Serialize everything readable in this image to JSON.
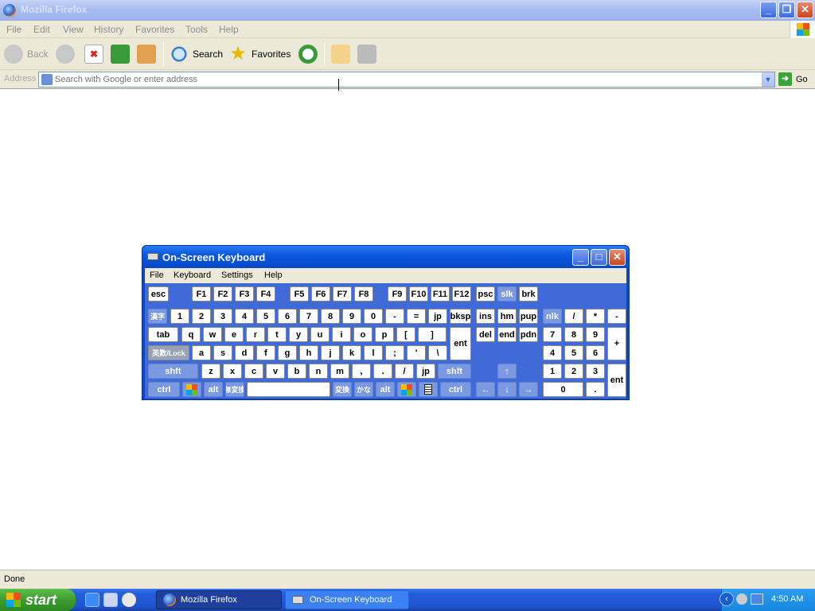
{
  "window": {
    "title": "Mozilla Firefox"
  },
  "menu": [
    "File",
    "Edit",
    "View",
    "History",
    "Favorites",
    "Tools",
    "Help"
  ],
  "toolbar": {
    "back": "Back",
    "search": "Search",
    "favorites": "Favorites"
  },
  "address": {
    "label": "Address",
    "placeholder": "Search with Google or enter address",
    "go": "Go"
  },
  "status": {
    "text": "Done"
  },
  "taskbar": {
    "start": "start",
    "tasks": [
      "Mozilla Firefox",
      "On-Screen Keyboard"
    ],
    "clock": "4:50 AM"
  },
  "osk": {
    "title": "On-Screen Keyboard",
    "menu": [
      "File",
      "Keyboard",
      "Settings",
      "Help"
    ],
    "keys": {
      "esc": "esc",
      "f1": "F1",
      "f2": "F2",
      "f3": "F3",
      "f4": "F4",
      "f5": "F5",
      "f6": "F6",
      "f7": "F7",
      "f8": "F8",
      "f9": "F9",
      "f10": "F10",
      "f11": "F11",
      "f12": "F12",
      "psc": "psc",
      "slk": "slk",
      "brk": "brk",
      "kanji": "漢字",
      "n1": "1",
      "n2": "2",
      "n3": "3",
      "n4": "4",
      "n5": "5",
      "n6": "6",
      "n7": "7",
      "n8": "8",
      "n9": "9",
      "n0": "0",
      "minus": "-",
      "equal": "=",
      "jp1": "jp",
      "bksp": "bksp",
      "ins": "ins",
      "hm": "hm",
      "pup": "pup",
      "nlk": "nlk",
      "kpdiv": "/",
      "kpmul": "*",
      "kpsub": "-",
      "tab": "tab",
      "q": "q",
      "w": "w",
      "e": "e",
      "r": "r",
      "t": "t",
      "y": "y",
      "u": "u",
      "i": "i",
      "o": "o",
      "p": "p",
      "lbr": "[",
      "rbr": "]",
      "ent": "ent",
      "del": "del",
      "end": "end",
      "pdn": "pdn",
      "kp7": "7",
      "kp8": "8",
      "kp9": "9",
      "kpadd": "+",
      "caps": "英数/Lock",
      "a": "a",
      "s": "s",
      "d": "d",
      "f": "f",
      "g": "g",
      "h": "h",
      "j": "j",
      "k": "k",
      "l": "l",
      "semi": ";",
      "quote": "'",
      "bslash": "\\",
      "kp4": "4",
      "kp5": "5",
      "kp6": "6",
      "lshft": "shft",
      "z": "z",
      "x": "x",
      "c": "c",
      "v": "v",
      "b": "b",
      "n": "n",
      "m": "m",
      "comma": ",",
      "period": ".",
      "slash": "/",
      "jp2": "jp",
      "rshft": "shft",
      "up": "↑",
      "kp1": "1",
      "kp2": "2",
      "kp3": "3",
      "kpent": "ent",
      "lctrl": "ctrl",
      "lalt": "alt",
      "muhenkan": "無変換",
      "henkan": "変換",
      "kana": "かな",
      "ralt": "alt",
      "rctrl": "ctrl",
      "left": "←",
      "down": "↓",
      "right": "→",
      "kp0": "0",
      "kpdot": "."
    }
  }
}
